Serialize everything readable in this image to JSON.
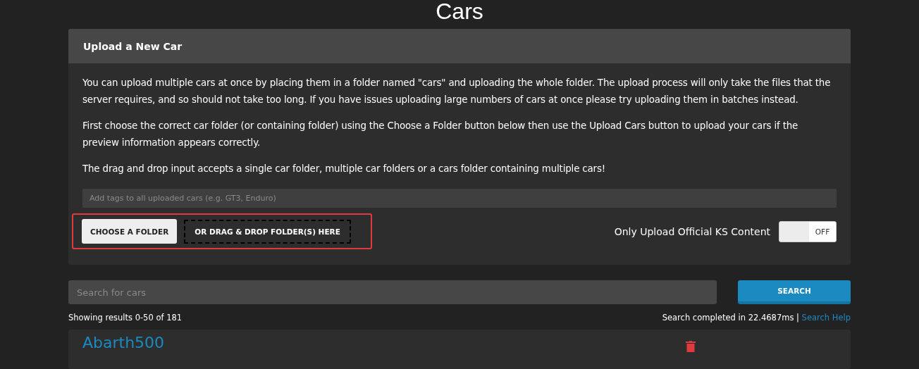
{
  "page_title": "Cars",
  "upload_panel": {
    "title": "Upload a New Car",
    "paragraphs": [
      "You can upload multiple cars at once by placing them in a folder named \"cars\" and uploading the whole folder. The upload process will only take the files that the server requires, and so should not take too long. If you have issues uploading large numbers of cars at once please try uploading them in batches instead.",
      "First choose the correct car folder (or containing folder) using the Choose a Folder button below then use the Upload Cars button to upload your cars if the preview information appears correctly.",
      "The drag and drop input accepts a single car folder, multiple car folders or a cars folder containing multiple cars!"
    ],
    "tags_field": {
      "placeholder": "Add tags to all uploaded cars (e.g. GT3, Enduro)"
    },
    "choose_button": "CHOOSE A FOLDER",
    "drop_zone": "OR DRAG & DROP FOLDER(S) HERE",
    "official_toggle": {
      "label": "Only Upload Official KS Content",
      "state_text": "OFF",
      "on": false
    }
  },
  "search": {
    "placeholder": "Search for cars",
    "button": "SEARCH"
  },
  "results_summary": "Showing results 0-50 of 181",
  "search_timing": "Search completed in 22.4687ms",
  "separator": "|",
  "search_help": "Search Help",
  "cars": [
    {
      "name": "Abarth500"
    }
  ]
}
